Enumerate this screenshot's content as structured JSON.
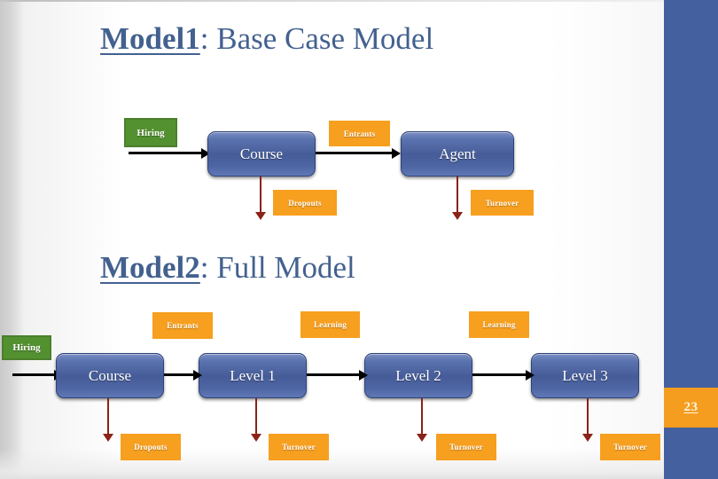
{
  "slide": {
    "page_number": "23",
    "accent_blue": "#44609f",
    "accent_orange": "#f59d1f",
    "node_blue": "#465c99",
    "source_green": "#539130",
    "title_color": "#43618f",
    "arrow_black": "#000000",
    "arrow_red": "#8b2218"
  },
  "model1": {
    "title_accent": "Model1",
    "title_rest": ": Base Case Model",
    "source": {
      "label": "Hiring"
    },
    "nodes": [
      {
        "label": "Course"
      },
      {
        "label": "Agent"
      }
    ],
    "flow_labels": [
      {
        "label": "Entrants"
      },
      {
        "label": "Dropouts"
      },
      {
        "label": "Turnover"
      }
    ]
  },
  "model2": {
    "title_accent": "Model2",
    "title_rest": ": Full Model",
    "source": {
      "label": "Hiring"
    },
    "nodes": [
      {
        "label": "Course"
      },
      {
        "label": "Level 1"
      },
      {
        "label": "Level 2"
      },
      {
        "label": "Level 3"
      }
    ],
    "top_labels": [
      {
        "label": "Entrants"
      },
      {
        "label": "Learning"
      },
      {
        "label": "Learning"
      }
    ],
    "bottom_labels": [
      {
        "label": "Dropouts"
      },
      {
        "label": "Turnover"
      },
      {
        "label": "Turnover"
      },
      {
        "label": "Turnover"
      }
    ]
  }
}
